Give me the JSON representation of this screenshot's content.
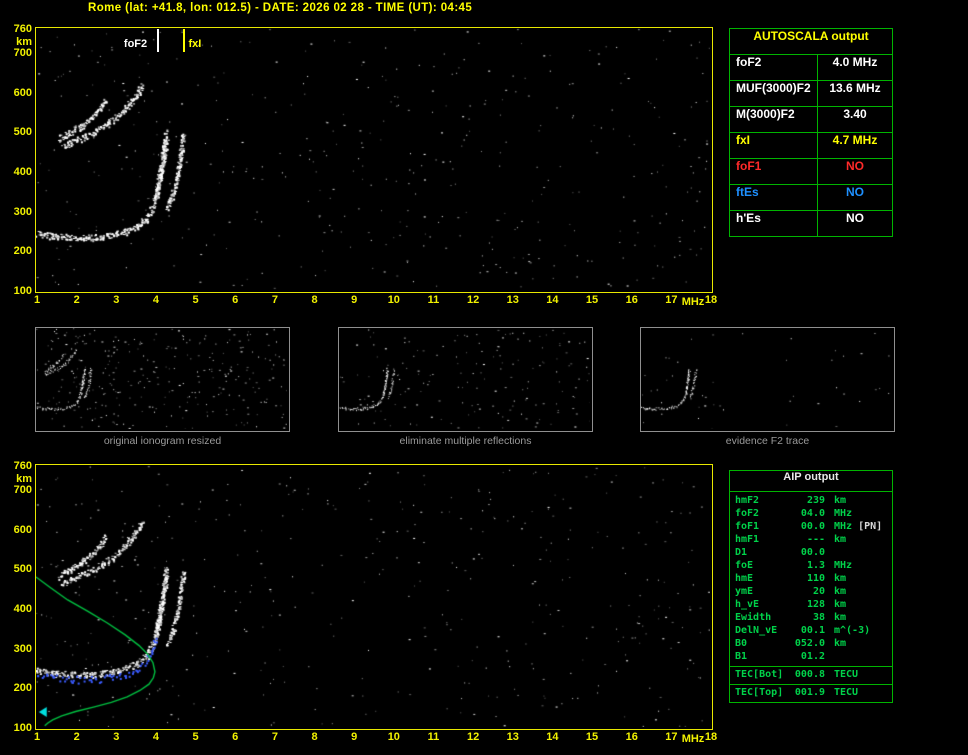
{
  "title": "Rome (lat: +41.8, lon: 012.5) - DATE: 2026 02 28 - TIME (UT): 04:45",
  "colors": {
    "accent_axis": "#f2f200",
    "plot_border": "#e8e800",
    "table_border": "#00b400",
    "profile": "#00c040",
    "fit": "#3a5bff",
    "cyan": "#00dede",
    "noise": [
      "#ffffff",
      "#cccccc",
      "#909090",
      "#606060"
    ]
  },
  "axes": {
    "x_ticks": [
      "1",
      "2",
      "3",
      "4",
      "5",
      "6",
      "7",
      "8",
      "9",
      "10",
      "11",
      "12",
      "13",
      "14",
      "15",
      "16",
      "17",
      "18"
    ],
    "x_unit": "MHz",
    "y_ticks": [
      "760",
      "700",
      "600",
      "500",
      "400",
      "300",
      "200",
      "100"
    ],
    "y_unit": "km"
  },
  "markers": {
    "fof2": {
      "label": "foF2",
      "freq": 4.05,
      "color": "#ffffff"
    },
    "fxi": {
      "label": "fxI",
      "freq": 4.72,
      "color": "#ffff00"
    }
  },
  "autoscala": {
    "header": "AUTOSCALA output",
    "rows": [
      {
        "label": "foF2",
        "value": "4.0 MHz",
        "color": "#ffffff"
      },
      {
        "label": "MUF(3000)F2",
        "value": "13.6 MHz",
        "color": "#ffffff"
      },
      {
        "label": "M(3000)F2",
        "value": "3.40",
        "color": "#ffffff"
      },
      {
        "label": "fxI",
        "value": "4.7 MHz",
        "color": "#ffff00"
      },
      {
        "label": "foF1",
        "value": "NO",
        "color": "#ff2a2a"
      },
      {
        "label": "ftEs",
        "value": "NO",
        "color": "#1e90ff"
      },
      {
        "label": "h'Es",
        "value": "NO",
        "color": "#ffffff"
      }
    ]
  },
  "thumbs": [
    {
      "caption": "original ionogram resized"
    },
    {
      "caption": "eliminate multiple reflections"
    },
    {
      "caption": "evidence F2 trace"
    }
  ],
  "aip": {
    "header": "AIP output",
    "rows": [
      {
        "label": "hmF2",
        "value": "239",
        "unit": "km",
        "note": ""
      },
      {
        "label": "foF2",
        "value": "04.0",
        "unit": "MHz",
        "note": ""
      },
      {
        "label": "foF1",
        "value": "00.0",
        "unit": "MHz",
        "note": "[PN]"
      },
      {
        "label": "hmF1",
        "value": "---",
        "unit": "km",
        "note": ""
      },
      {
        "label": "D1",
        "value": "00.0",
        "unit": "",
        "note": ""
      },
      {
        "label": "foE",
        "value": "1.3",
        "unit": "MHz",
        "note": ""
      },
      {
        "label": "hmE",
        "value": "110",
        "unit": "km",
        "note": ""
      },
      {
        "label": "ymE",
        "value": "20",
        "unit": "km",
        "note": ""
      },
      {
        "label": "h_vE",
        "value": "128",
        "unit": "km",
        "note": ""
      },
      {
        "label": "Ewidth",
        "value": "38",
        "unit": "km",
        "note": ""
      },
      {
        "label": "DelN_vE",
        "value": "00.1",
        "unit": "m^(-3)",
        "note": ""
      },
      {
        "label": "B0",
        "value": "052.0",
        "unit": "km",
        "note": ""
      },
      {
        "label": "B1",
        "value": "01.2",
        "unit": "",
        "note": ""
      }
    ],
    "tec_rows": [
      {
        "label": "TEC[Bot]",
        "value": "000.8",
        "unit": "TECU",
        "note": ""
      },
      {
        "label": "TEC[Top]",
        "value": "001.9",
        "unit": "TECU",
        "note": ""
      }
    ]
  },
  "chart_data": {
    "type": "scatter",
    "title": "Ionogram, Rome 2026-02-28 04:45 UT",
    "xlabel": "MHz",
    "ylabel": "km",
    "x_range": [
      1,
      18
    ],
    "y_range": [
      100,
      760
    ],
    "f2_trace": [
      [
        1.0,
        242
      ],
      [
        1.4,
        237
      ],
      [
        1.9,
        233
      ],
      [
        2.4,
        233
      ],
      [
        2.9,
        238
      ],
      [
        3.25,
        247
      ],
      [
        3.55,
        260
      ],
      [
        3.78,
        280
      ],
      [
        3.92,
        305
      ],
      [
        4.02,
        340
      ],
      [
        4.1,
        382
      ],
      [
        4.17,
        425
      ],
      [
        4.23,
        468
      ],
      [
        4.27,
        498
      ]
    ],
    "x_trace": [
      [
        4.3,
        308
      ],
      [
        4.42,
        338
      ],
      [
        4.52,
        375
      ],
      [
        4.6,
        415
      ],
      [
        4.66,
        455
      ],
      [
        4.71,
        492
      ]
    ],
    "blob": [
      [
        4.02,
        330
      ],
      [
        4.1,
        370
      ],
      [
        4.17,
        410
      ],
      [
        4.23,
        450
      ],
      [
        4.28,
        480
      ]
    ],
    "second_hop": [
      [
        1.65,
        462
      ],
      [
        2.0,
        477
      ],
      [
        2.4,
        496
      ],
      [
        2.8,
        518
      ],
      [
        3.1,
        542
      ],
      [
        3.35,
        568
      ],
      [
        3.55,
        596
      ],
      [
        3.68,
        618
      ]
    ],
    "second_hop_b": [
      [
        1.55,
        480
      ],
      [
        1.85,
        497
      ],
      [
        2.15,
        516
      ],
      [
        2.4,
        536
      ],
      [
        2.6,
        558
      ],
      [
        2.75,
        580
      ]
    ],
    "profile": [
      [
        1.0,
        478
      ],
      [
        1.35,
        452
      ],
      [
        1.8,
        420
      ],
      [
        2.3,
        392
      ],
      [
        2.8,
        362
      ],
      [
        3.25,
        332
      ],
      [
        3.6,
        305
      ],
      [
        3.82,
        283
      ],
      [
        3.95,
        262
      ],
      [
        4.0,
        239
      ],
      [
        3.96,
        224
      ],
      [
        3.85,
        208
      ],
      [
        3.62,
        192
      ],
      [
        3.3,
        176
      ],
      [
        2.9,
        162
      ],
      [
        2.45,
        150
      ],
      [
        2.0,
        139
      ],
      [
        1.65,
        128
      ],
      [
        1.42,
        118
      ],
      [
        1.3,
        110
      ],
      [
        1.22,
        103
      ]
    ],
    "fit_range": [
      1.0,
      4.05
    ],
    "key_values": {
      "foF2_MHz": 4.0,
      "fxI_MHz": 4.7,
      "hmF2_km": 239,
      "foE_MHz": 1.3,
      "hmE_km": 110
    }
  }
}
